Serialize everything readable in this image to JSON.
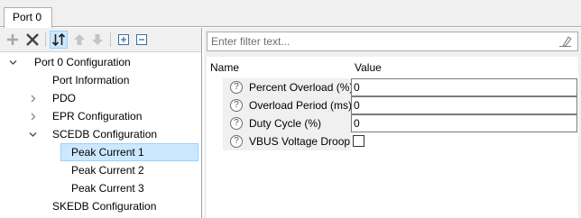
{
  "tabs": [
    {
      "label": "Port 0"
    }
  ],
  "toolbar": {
    "buttons": [
      {
        "icon": "add-icon",
        "enabled": false
      },
      {
        "icon": "delete-icon",
        "enabled": true
      },
      {
        "icon": "sort-icon",
        "enabled": true,
        "active": true
      },
      {
        "icon": "move-up-icon",
        "enabled": false
      },
      {
        "icon": "move-down-icon",
        "enabled": false
      },
      {
        "icon": "expand-all-icon",
        "enabled": true
      },
      {
        "icon": "collapse-all-icon",
        "enabled": true
      }
    ]
  },
  "tree": {
    "items": [
      {
        "label": "Port 0 Configuration",
        "expander": "expanded"
      },
      {
        "label": "Port Information",
        "expander": "none"
      },
      {
        "label": "PDO",
        "expander": "collapsed"
      },
      {
        "label": "EPR Configuration",
        "expander": "collapsed"
      },
      {
        "label": "SCEDB Configuration",
        "expander": "expanded"
      },
      {
        "label": "Peak Current 1",
        "expander": "none",
        "selected": true
      },
      {
        "label": "Peak Current 2",
        "expander": "none"
      },
      {
        "label": "Peak Current 3",
        "expander": "none"
      },
      {
        "label": "SKEDB Configuration",
        "expander": "none"
      }
    ]
  },
  "filter": {
    "placeholder": "Enter filter text..."
  },
  "grid": {
    "headers": {
      "name": "Name",
      "value": "Value"
    },
    "rows": [
      {
        "help": "?",
        "name": "Percent Overload (%)",
        "value": "0",
        "type": "text"
      },
      {
        "help": "?",
        "name": "Overload Period (ms)",
        "value": "0",
        "type": "text"
      },
      {
        "help": "?",
        "name": "Duty Cycle (%)",
        "value": "0",
        "type": "text"
      },
      {
        "help": "?",
        "name": "VBUS Voltage Droop",
        "checked": false,
        "type": "checkbox"
      }
    ]
  },
  "colors": {
    "selection": "#cce8ff",
    "selection_border": "#99d1ff",
    "panel": "#f0f0f0"
  }
}
